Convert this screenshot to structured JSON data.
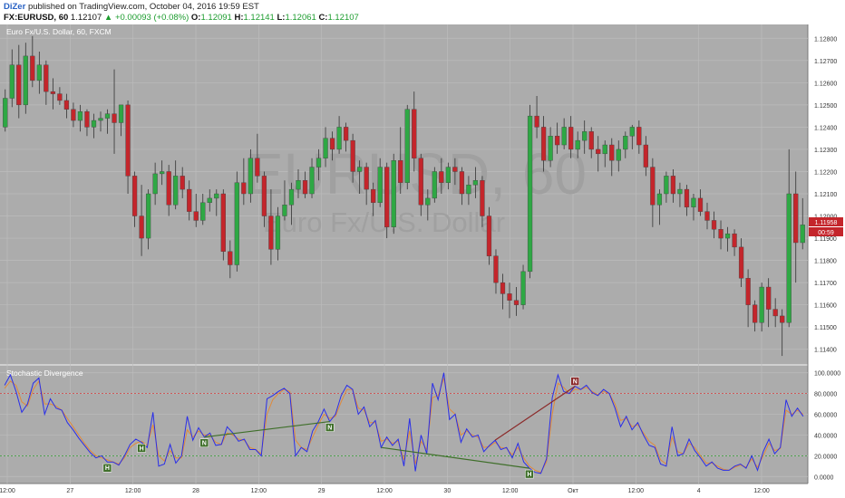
{
  "header": {
    "author": "DiZer",
    "published_text": "published on TradingView.com, October 04, 2016 19:59 EST",
    "symbol": "FX:EURUSD, 60",
    "last": "1.12107",
    "change_arrow": "▲",
    "change": "+0.00093 (+0.08%)",
    "o_label": "O:",
    "o_value": "1.12091",
    "h_label": "H:",
    "h_value": "1.12141",
    "l_label": "L:",
    "l_value": "1.12061",
    "c_label": "C:",
    "c_value": "1.12107"
  },
  "main_panel": {
    "title": "Euro Fx/U.S. Dollar, 60, FXCM",
    "watermark_symbol": "EURUSD, 60",
    "watermark_name": "Euro Fx/U.S. Dollar",
    "price_badge": "1.11958",
    "time_badge": "00:59"
  },
  "sub_panel": {
    "title": "Stochastic Divergence"
  },
  "time_axis": [
    "12:00",
    "27",
    "12:00",
    "28",
    "12:00",
    "29",
    "12:00",
    "30",
    "12:00",
    "Окт",
    "12:00",
    "4",
    "12:00"
  ],
  "colors": {
    "panel_bg": "#acacac",
    "bull": "#2ea844",
    "bear": "#c4252b",
    "k_line": "#2a2ee8",
    "d_line": "#e08a3a",
    "overbought": "#d33b3b",
    "oversold": "#2e9c2e",
    "bear_div": "#8b2a2a",
    "bull_div": "#3f6f2a"
  },
  "chart_data": [
    {
      "type": "candlestick",
      "title": "Euro Fx/U.S. Dollar, 60, FXCM",
      "ylim": [
        1.1135,
        1.1285
      ],
      "y_ticks": [
        "1.12800",
        "1.12700",
        "1.12600",
        "1.12500",
        "1.12400",
        "1.12300",
        "1.12200",
        "1.12100",
        "1.12000",
        "1.11900",
        "1.11800",
        "1.11700",
        "1.11600",
        "1.11500",
        "1.11400"
      ],
      "grid": true,
      "ohlc": [
        [
          1.124,
          1.1257,
          1.1238,
          1.1253
        ],
        [
          1.1253,
          1.1275,
          1.1249,
          1.1268
        ],
        [
          1.1268,
          1.1277,
          1.1244,
          1.125
        ],
        [
          1.125,
          1.1278,
          1.1246,
          1.1272
        ],
        [
          1.1272,
          1.1281,
          1.1258,
          1.1261
        ],
        [
          1.1261,
          1.1274,
          1.1255,
          1.1268
        ],
        [
          1.1268,
          1.127,
          1.125,
          1.1256
        ],
        [
          1.1256,
          1.1262,
          1.1248,
          1.1255
        ],
        [
          1.1255,
          1.1258,
          1.125,
          1.1252
        ],
        [
          1.1252,
          1.1255,
          1.1244,
          1.1248
        ],
        [
          1.1248,
          1.1251,
          1.124,
          1.1243
        ],
        [
          1.1243,
          1.125,
          1.1238,
          1.1247
        ],
        [
          1.1247,
          1.1248,
          1.1236,
          1.124
        ],
        [
          1.124,
          1.1246,
          1.1235,
          1.1243
        ],
        [
          1.1243,
          1.1247,
          1.1238,
          1.1244
        ],
        [
          1.1244,
          1.1248,
          1.1237,
          1.1246
        ],
        [
          1.1246,
          1.1266,
          1.1228,
          1.1242
        ],
        [
          1.1242,
          1.1249,
          1.1236,
          1.125
        ],
        [
          1.125,
          1.1252,
          1.121,
          1.1218
        ],
        [
          1.1218,
          1.122,
          1.1195,
          1.12
        ],
        [
          1.12,
          1.1214,
          1.1182,
          1.119
        ],
        [
          1.119,
          1.1212,
          1.1185,
          1.121
        ],
        [
          1.121,
          1.1224,
          1.1205,
          1.1219
        ],
        [
          1.1219,
          1.1225,
          1.1214,
          1.122
        ],
        [
          1.122,
          1.1223,
          1.12,
          1.1205
        ],
        [
          1.1205,
          1.1225,
          1.1203,
          1.1218
        ],
        [
          1.1218,
          1.1222,
          1.1208,
          1.1212
        ],
        [
          1.1212,
          1.1216,
          1.1198,
          1.1202
        ],
        [
          1.1202,
          1.121,
          1.1195,
          1.1198
        ],
        [
          1.1198,
          1.121,
          1.1196,
          1.1206
        ],
        [
          1.1206,
          1.1212,
          1.1202,
          1.1208
        ],
        [
          1.1208,
          1.1212,
          1.12,
          1.121
        ],
        [
          1.121,
          1.1212,
          1.118,
          1.1184
        ],
        [
          1.1184,
          1.1189,
          1.1172,
          1.1178
        ],
        [
          1.1178,
          1.122,
          1.1175,
          1.1215
        ],
        [
          1.1215,
          1.1226,
          1.1205,
          1.121
        ],
        [
          1.121,
          1.123,
          1.1206,
          1.1226
        ],
        [
          1.1226,
          1.1237,
          1.1215,
          1.1218
        ],
        [
          1.1218,
          1.122,
          1.1195,
          1.12
        ],
        [
          1.12,
          1.1212,
          1.1178,
          1.1185
        ],
        [
          1.1185,
          1.1204,
          1.118,
          1.12
        ],
        [
          1.12,
          1.1216,
          1.1198,
          1.1205
        ],
        [
          1.1205,
          1.1215,
          1.1196,
          1.1212
        ],
        [
          1.1212,
          1.1221,
          1.1208,
          1.1216
        ],
        [
          1.1216,
          1.122,
          1.1208,
          1.121
        ],
        [
          1.121,
          1.1226,
          1.1208,
          1.1222
        ],
        [
          1.1222,
          1.123,
          1.1216,
          1.1226
        ],
        [
          1.1226,
          1.124,
          1.1222,
          1.1235
        ],
        [
          1.1235,
          1.1238,
          1.1225,
          1.123
        ],
        [
          1.123,
          1.1245,
          1.1228,
          1.124
        ],
        [
          1.124,
          1.1242,
          1.1229,
          1.1234
        ],
        [
          1.1234,
          1.1237,
          1.1215,
          1.122
        ],
        [
          1.122,
          1.1225,
          1.121,
          1.1222
        ],
        [
          1.1222,
          1.1224,
          1.1205,
          1.1212
        ],
        [
          1.1212,
          1.1215,
          1.12,
          1.1206
        ],
        [
          1.1206,
          1.1226,
          1.1204,
          1.1222
        ],
        [
          1.1222,
          1.1224,
          1.119,
          1.1195
        ],
        [
          1.1195,
          1.1228,
          1.1192,
          1.1225
        ],
        [
          1.1225,
          1.124,
          1.121,
          1.1215
        ],
        [
          1.1215,
          1.125,
          1.1212,
          1.1248
        ],
        [
          1.1248,
          1.1256,
          1.122,
          1.1226
        ],
        [
          1.1226,
          1.1228,
          1.12,
          1.1205
        ],
        [
          1.1205,
          1.1212,
          1.1198,
          1.1208
        ],
        [
          1.1208,
          1.1222,
          1.1206,
          1.122
        ],
        [
          1.122,
          1.1226,
          1.121,
          1.1215
        ],
        [
          1.1215,
          1.1224,
          1.1212,
          1.1222
        ],
        [
          1.1222,
          1.1226,
          1.1214,
          1.122
        ],
        [
          1.122,
          1.1222,
          1.1205,
          1.121
        ],
        [
          1.121,
          1.1218,
          1.1205,
          1.1214
        ],
        [
          1.1214,
          1.1222,
          1.1208,
          1.1216
        ],
        [
          1.1216,
          1.1218,
          1.1195,
          1.12
        ],
        [
          1.12,
          1.1204,
          1.1178,
          1.1182
        ],
        [
          1.1182,
          1.1185,
          1.1165,
          1.117
        ],
        [
          1.117,
          1.1174,
          1.1158,
          1.1165
        ],
        [
          1.1165,
          1.117,
          1.1154,
          1.1162
        ],
        [
          1.1162,
          1.1168,
          1.1155,
          1.116
        ],
        [
          1.116,
          1.1178,
          1.1158,
          1.1175
        ],
        [
          1.1175,
          1.125,
          1.1172,
          1.1245
        ],
        [
          1.1245,
          1.1254,
          1.1235,
          1.124
        ],
        [
          1.124,
          1.1245,
          1.122,
          1.1225
        ],
        [
          1.1225,
          1.124,
          1.1222,
          1.1236
        ],
        [
          1.1236,
          1.1242,
          1.1228,
          1.1232
        ],
        [
          1.1232,
          1.1244,
          1.123,
          1.124
        ],
        [
          1.124,
          1.1245,
          1.1226,
          1.123
        ],
        [
          1.123,
          1.1238,
          1.1226,
          1.1234
        ],
        [
          1.1234,
          1.1243,
          1.1228,
          1.1238
        ],
        [
          1.1238,
          1.124,
          1.1226,
          1.123
        ],
        [
          1.123,
          1.1236,
          1.122,
          1.1228
        ],
        [
          1.1228,
          1.1234,
          1.1222,
          1.1232
        ],
        [
          1.1232,
          1.1235,
          1.1218,
          1.1225
        ],
        [
          1.1225,
          1.1234,
          1.122,
          1.123
        ],
        [
          1.123,
          1.1238,
          1.1226,
          1.1236
        ],
        [
          1.1236,
          1.1241,
          1.123,
          1.124
        ],
        [
          1.124,
          1.1243,
          1.1228,
          1.1232
        ],
        [
          1.1232,
          1.1236,
          1.1218,
          1.1222
        ],
        [
          1.1222,
          1.1226,
          1.1195,
          1.1205
        ],
        [
          1.1205,
          1.1212,
          1.1196,
          1.121
        ],
        [
          1.121,
          1.122,
          1.1206,
          1.1218
        ],
        [
          1.1218,
          1.1221,
          1.1206,
          1.121
        ],
        [
          1.121,
          1.1215,
          1.1204,
          1.1212
        ],
        [
          1.1212,
          1.1214,
          1.12,
          1.1204
        ],
        [
          1.1204,
          1.121,
          1.1198,
          1.1208
        ],
        [
          1.1208,
          1.1212,
          1.12,
          1.1202
        ],
        [
          1.1202,
          1.1206,
          1.1194,
          1.1198
        ],
        [
          1.1198,
          1.1202,
          1.119,
          1.1194
        ],
        [
          1.1194,
          1.1198,
          1.1185,
          1.119
        ],
        [
          1.119,
          1.1195,
          1.1184,
          1.1192
        ],
        [
          1.1192,
          1.1194,
          1.1182,
          1.1186
        ],
        [
          1.1186,
          1.119,
          1.1168,
          1.1172
        ],
        [
          1.1172,
          1.1176,
          1.115,
          1.116
        ],
        [
          1.116,
          1.1162,
          1.1148,
          1.1152
        ],
        [
          1.1152,
          1.117,
          1.1148,
          1.1168
        ],
        [
          1.1168,
          1.1172,
          1.115,
          1.1158
        ],
        [
          1.1158,
          1.1163,
          1.115,
          1.1155
        ],
        [
          1.1155,
          1.1158,
          1.1137,
          1.1152
        ],
        [
          1.1152,
          1.123,
          1.115,
          1.121
        ],
        [
          1.121,
          1.122,
          1.117,
          1.1188
        ],
        [
          1.1188,
          1.1208,
          1.1185,
          1.1196
        ]
      ]
    },
    {
      "type": "line",
      "title": "Stochastic Divergence",
      "ylim": [
        -5,
        105
      ],
      "y_ticks": [
        "100.0000",
        "80.0000",
        "60.0000",
        "40.0000",
        "20.0000",
        "0.0000"
      ],
      "levels": [
        80,
        20
      ],
      "series": [
        {
          "values": [
            88,
            98,
            82,
            62,
            70,
            90,
            95,
            60,
            75,
            66,
            64,
            52,
            45,
            37,
            30,
            23,
            18,
            20,
            14,
            14,
            11,
            20,
            31,
            36,
            33,
            28,
            62,
            10,
            12,
            31,
            13,
            20,
            58,
            35,
            47,
            38,
            42,
            30,
            31,
            48,
            42,
            34,
            36,
            26,
            26,
            20,
            75,
            78,
            82,
            85,
            80,
            20,
            28,
            24,
            44,
            53,
            65,
            53,
            60,
            78,
            88,
            84,
            60,
            67,
            48,
            54,
            28,
            38,
            30,
            36,
            10,
            56,
            5,
            40,
            22,
            90,
            74,
            100,
            55,
            60,
            33,
            46,
            38,
            40,
            24,
            30,
            35,
            26,
            28,
            18,
            32,
            14,
            8,
            4,
            3,
            17,
            76,
            98,
            82,
            80,
            87,
            84,
            88,
            81,
            78,
            84,
            80,
            66,
            48,
            58,
            45,
            52,
            40,
            30,
            28,
            12,
            10,
            48,
            20,
            22,
            36,
            25,
            18,
            10,
            14,
            8,
            6,
            6,
            10,
            12,
            8,
            20,
            6,
            24,
            36,
            22,
            28,
            74,
            58,
            66,
            58
          ]
        },
        {
          "values": [
            85,
            92,
            88,
            72,
            68,
            84,
            92,
            70,
            70,
            68,
            64,
            56,
            48,
            40,
            32,
            25,
            20,
            18,
            16,
            14,
            12,
            18,
            28,
            32,
            34,
            30,
            50,
            20,
            15,
            25,
            18,
            18,
            45,
            38,
            44,
            40,
            40,
            33,
            31,
            42,
            40,
            36,
            35,
            28,
            26,
            22,
            60,
            74,
            80,
            84,
            82,
            35,
            28,
            26,
            38,
            50,
            60,
            56,
            58,
            72,
            84,
            84,
            66,
            64,
            52,
            52,
            34,
            36,
            32,
            34,
            16,
            44,
            12,
            34,
            26,
            76,
            78,
            95,
            65,
            60,
            40,
            44,
            40,
            38,
            28,
            29,
            33,
            28,
            27,
            21,
            28,
            18,
            10,
            6,
            4,
            14,
            60,
            90,
            86,
            80,
            84,
            84,
            86,
            82,
            79,
            82,
            80,
            70,
            54,
            56,
            48,
            50,
            42,
            34,
            30,
            16,
            12,
            38,
            24,
            22,
            32,
            28,
            20,
            13,
            13,
            10,
            7,
            6,
            9,
            11,
            9,
            17,
            9,
            20,
            32,
            25,
            27,
            64,
            60,
            64,
            60
          ]
        }
      ],
      "divergences": [
        {
          "label": "H",
          "kind": "bullish",
          "from_bar": 18,
          "to_bar": 18
        },
        {
          "label": "H",
          "kind": "bullish",
          "from_bar": 24,
          "to_bar": 24
        },
        {
          "label": "N",
          "kind": "bullish",
          "from_bar": 35,
          "to_bar": 35
        },
        {
          "label": "N",
          "kind": "bullish",
          "from_bar": 35,
          "to_bar": 57
        },
        {
          "label": "N",
          "kind": "bearish",
          "from_bar": 86,
          "to_bar": 100
        },
        {
          "label": "H",
          "kind": "bullish",
          "from_bar": 66,
          "to_bar": 92
        },
        {
          "label": "H",
          "kind": "bullish",
          "from_bar": 158,
          "to_bar": 170
        },
        {
          "label": "N",
          "kind": "bullish",
          "from_bar": 174,
          "to_bar": 182
        }
      ]
    }
  ]
}
